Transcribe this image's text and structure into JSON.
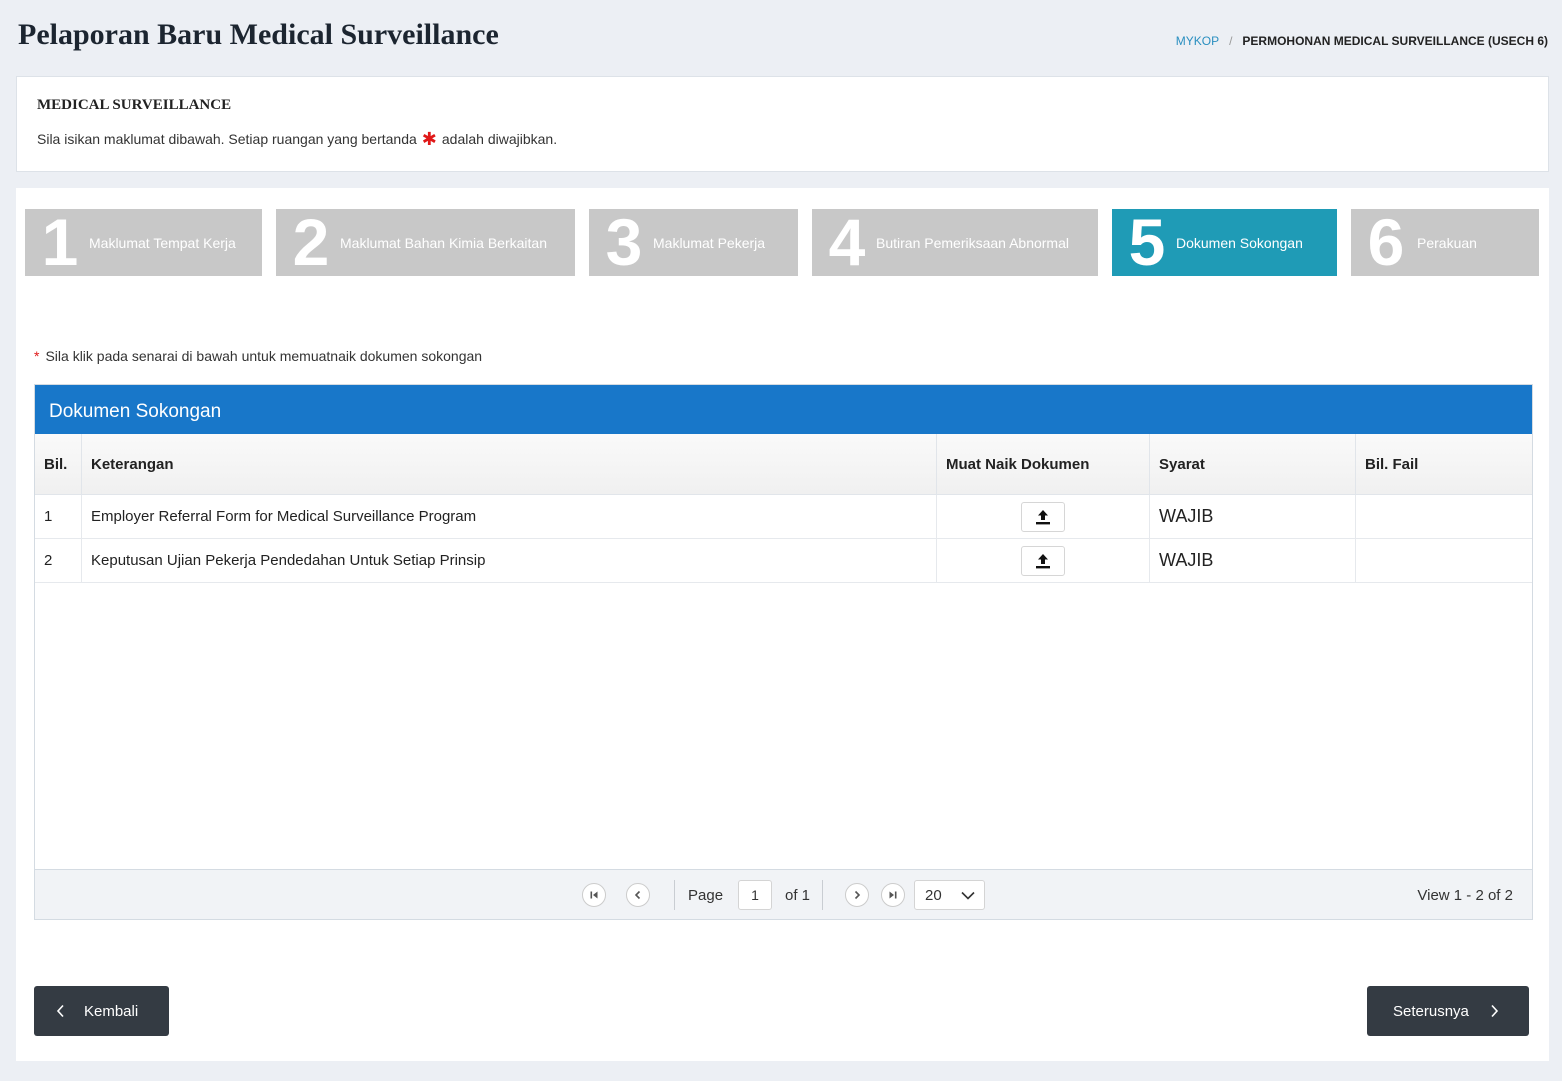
{
  "header": {
    "title": "Pelaporan Baru Medical Surveillance",
    "breadcrumb": {
      "home": "MYKOP",
      "separator": "/",
      "current": "PERMOHONAN MEDICAL SURVEILLANCE (USECH 6)"
    }
  },
  "info": {
    "title": "MEDICAL SURVEILLANCE",
    "text_before": "Sila isikan maklumat dibawah. Setiap ruangan yang bertanda",
    "star": "✱",
    "text_after": "adalah diwajibkan."
  },
  "wizard": {
    "active_step": 5,
    "steps": [
      {
        "number": "1",
        "label": "Maklumat Tempat Kerja"
      },
      {
        "number": "2",
        "label": "Maklumat Bahan Kimia Berkaitan"
      },
      {
        "number": "3",
        "label": "Maklumat Pekerja"
      },
      {
        "number": "4",
        "label": "Butiran Pemeriksaan Abnormal"
      },
      {
        "number": "5",
        "label": "Dokumen Sokongan"
      },
      {
        "number": "6",
        "label": "Perakuan"
      }
    ]
  },
  "hint": {
    "marker": "*",
    "text": "Sila klik pada senarai di bawah untuk memuatnaik dokumen sokongan"
  },
  "grid": {
    "caption": "Dokumen Sokongan",
    "columns": [
      "Bil.",
      "Keterangan",
      "Muat Naik Dokumen",
      "Syarat",
      "Bil. Fail"
    ],
    "rows": [
      {
        "bil": "1",
        "keterangan": "Employer Referral Form for Medical Surveillance Program",
        "syarat": "WAJIB",
        "bil_fail": ""
      },
      {
        "bil": "2",
        "keterangan": "Keputusan Ujian Pekerja Pendedahan Untuk Setiap Prinsip",
        "syarat": "WAJIB",
        "bil_fail": ""
      }
    ]
  },
  "pager": {
    "page_label": "Page",
    "page_value": "1",
    "of_label": "of 1",
    "rows_per_page": "20",
    "view_text": "View 1 - 2 of 2"
  },
  "buttons": {
    "back_label": "Kembali",
    "next_label": "Seterusnya"
  },
  "colors": {
    "active_step": "#1f9bb6",
    "inactive_step": "#c8c8c8",
    "grid_caption": "#1877c9",
    "nav_button": "#343b43",
    "required": "#e01818",
    "breadcrumb_link": "#2a8fc0"
  },
  "icons": {
    "upload": "upload-icon",
    "first_page": "first-page-icon",
    "prev_page": "prev-page-icon",
    "next_page": "next-page-icon",
    "last_page": "last-page-icon",
    "dropdown": "chevron-down-icon",
    "back": "chevron-left-icon",
    "next": "chevron-right-icon"
  }
}
